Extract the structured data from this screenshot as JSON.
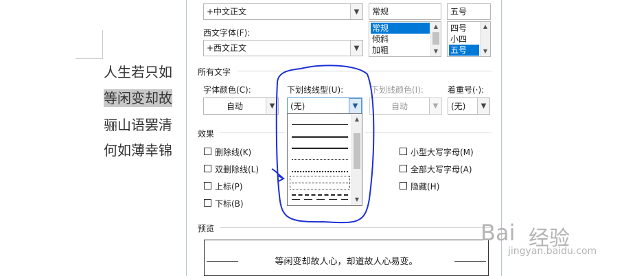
{
  "document": {
    "lines": [
      "人生若只如",
      "等闲变却故",
      "骊山语罢清",
      "何如薄幸锦"
    ]
  },
  "dialog": {
    "chinese_font": {
      "value": "+中文正文"
    },
    "western_font": {
      "label": "西文字体(F):",
      "value": "+西文正文"
    },
    "font_style": {
      "value": "常规",
      "options": [
        "常规",
        "倾斜",
        "加粗"
      ],
      "selected_index": 0
    },
    "font_size": {
      "value": "五号",
      "options": [
        "四号",
        "小四",
        "五号"
      ],
      "selected_index": 2
    },
    "all_text": {
      "section_label": "所有文字",
      "font_color": {
        "label": "字体颜色(C):",
        "value": "自动"
      },
      "underline_style": {
        "label": "下划线线型(U):",
        "value": "(无)",
        "options": [
          "single",
          "double",
          "thick",
          "dotted",
          "heavy-dotted",
          "dashed",
          "heavy-dashed",
          "long-dashed"
        ],
        "focused_index": 5
      },
      "underline_color": {
        "label": "下划线颜色(I):",
        "value": "自动",
        "enabled": false
      },
      "emphasis_mark": {
        "label": "着重号(·):",
        "value": "(无)"
      }
    },
    "effects": {
      "section_label": "效果",
      "left": [
        {
          "label": "删除线(K)",
          "checked": false
        },
        {
          "label": "双删除线(L)",
          "checked": false
        },
        {
          "label": "上标(P)",
          "checked": false
        },
        {
          "label": "下标(B)",
          "checked": false
        }
      ],
      "right": [
        {
          "label": "小型大写字母(M)",
          "checked": false
        },
        {
          "label": "全部大写字母(A)",
          "checked": false
        },
        {
          "label": "隐藏(H)",
          "checked": false
        }
      ]
    },
    "preview": {
      "section_label": "预览",
      "text": "等闲变却故人心，却道故人心易变。"
    }
  },
  "watermark": {
    "brand": "经验",
    "url": "jingyan.baidu.com"
  },
  "colors": {
    "selection": "#0078d7",
    "annotation": "#1c2fd6",
    "highlight": "#c8c8c8"
  },
  "icons": [
    "chevron-down-icon",
    "scroll-up-icon",
    "scroll-down-icon",
    "checkbox-icon",
    "arrow-annotation"
  ]
}
